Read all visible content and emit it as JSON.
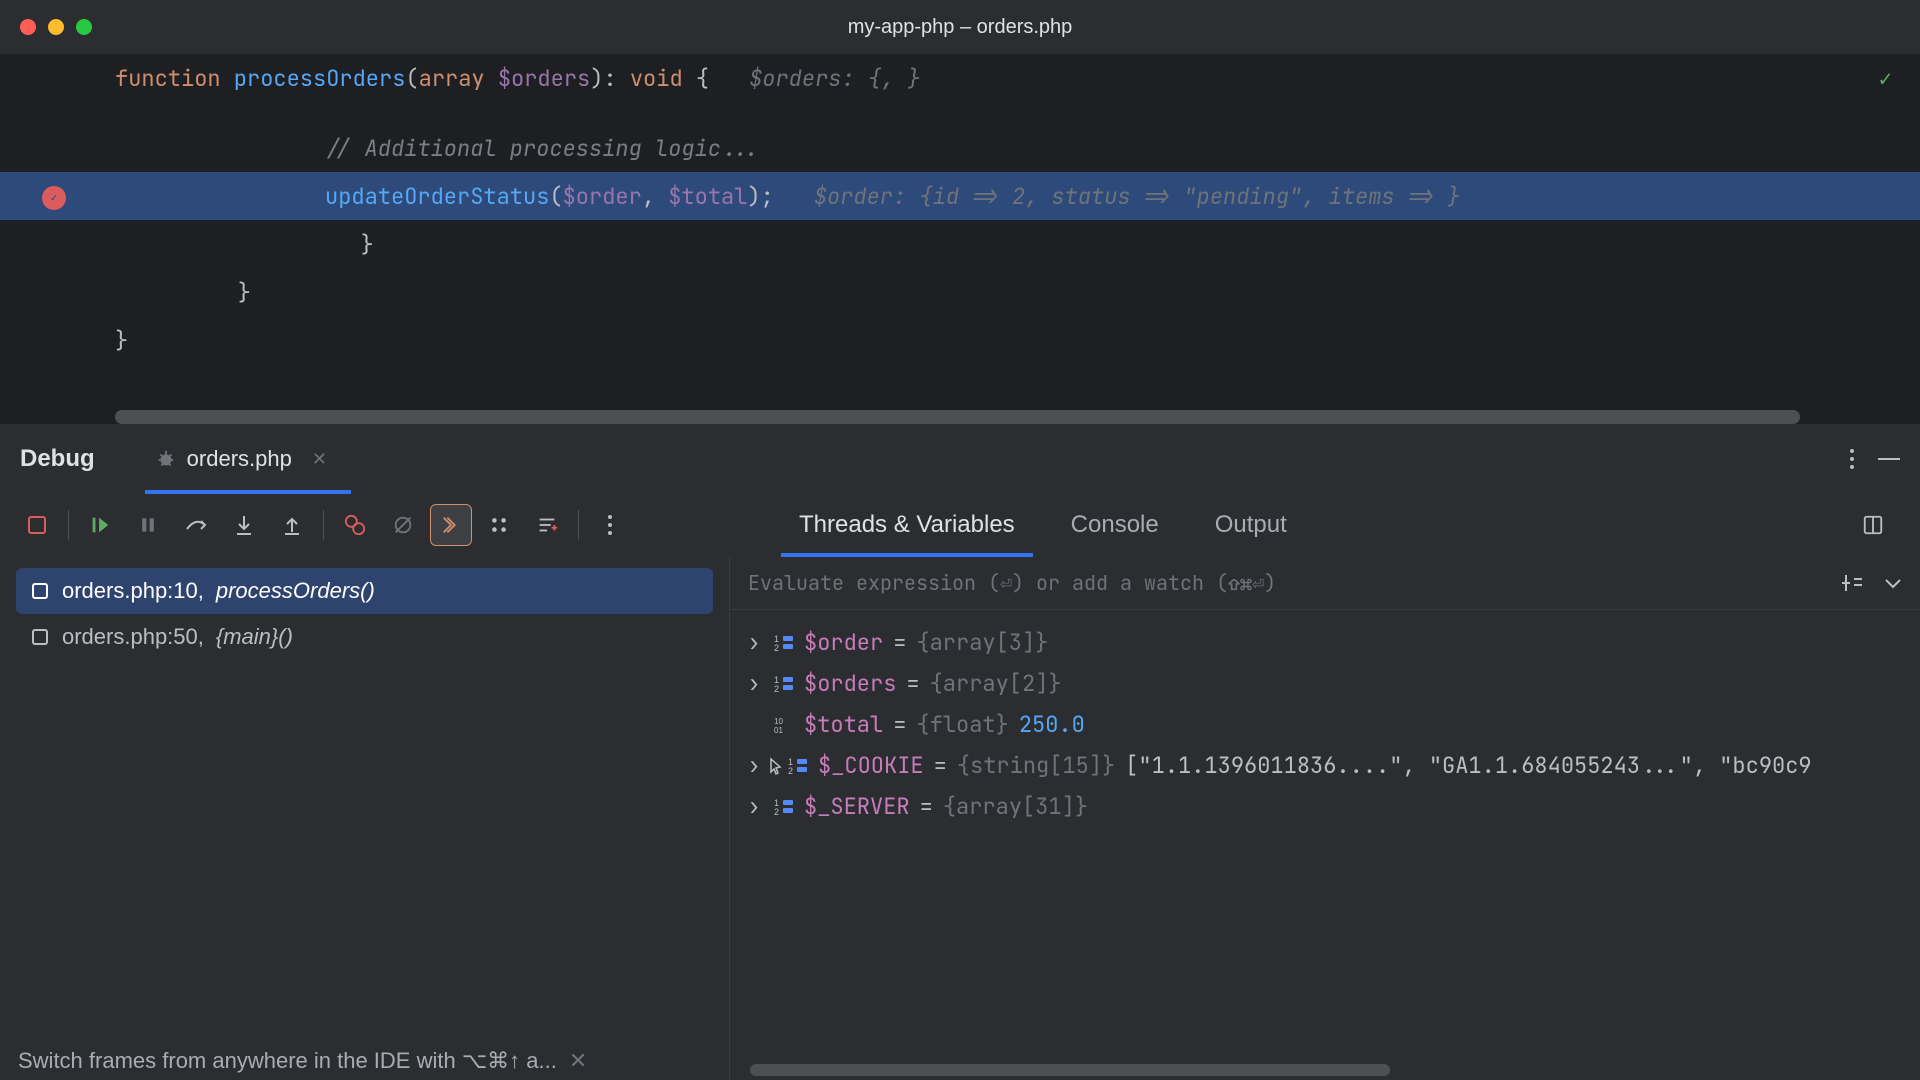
{
  "window": {
    "title": "my-app-php – orders.php"
  },
  "editor": {
    "line1_kw": "function",
    "line1_fn": " processOrders",
    "line1_rest1": "(",
    "line1_rest2": "array ",
    "line1_rest3": "$orders",
    "line1_rest4": "): ",
    "line1_rest5": "void ",
    "line1_rest6": "{",
    "line1_hint": "$orders: {, }",
    "line2_comment": "// Additional processing logic...",
    "line3_fn": "updateOrderStatus",
    "line3_p1": "(",
    "line3_var1": "$order",
    "line3_comma": ", ",
    "line3_var2": "$total",
    "line3_p2": ");",
    "line3_hint": "$order: {id => 2, status => \"pending\", items => }",
    "line4": "        }",
    "line5": "    }",
    "line6": "}"
  },
  "debug": {
    "title": "Debug",
    "tab_label": "orders.php",
    "right_tabs": {
      "t1": "Threads & Variables",
      "t2": "Console",
      "t3": "Output"
    },
    "frames": {
      "f1_loc": "orders.php:10, ",
      "f1_fn": "processOrders()",
      "f2_loc": "orders.php:50, ",
      "f2_fn": "{main}()"
    },
    "eval_placeholder": "Evaluate expression (⏎) or add a watch (⇧⌘⏎)",
    "vars": {
      "v1_name": "$order",
      "v1_type": "{array[3]}",
      "v2_name": "$orders",
      "v2_type": "{array[2]}",
      "v3_name": "$total",
      "v3_type": "{float}",
      "v3_val": "250.0",
      "v4_name": "$_COOKIE",
      "v4_type": "{string[15]}",
      "v4_val": "[\"1.1.1396011836....\", \"GA1.1.684055243...\", \"bc90c9",
      "v5_name": "$_SERVER",
      "v5_type": "{array[31]}"
    },
    "hint": "Switch frames from anywhere in the IDE with ⌥⌘↑ a..."
  }
}
